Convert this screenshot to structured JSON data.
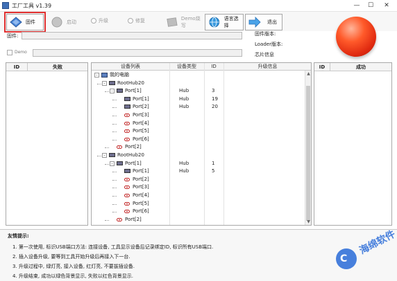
{
  "window": {
    "title": "工厂工具 v1.39",
    "minimize": "—",
    "maximize": "☐",
    "close": "✕"
  },
  "toolbar": {
    "firmware": "固件",
    "start": "启动",
    "upgrade_radio": "升级",
    "repair_radio": "修复",
    "demo_write": "Demo烧写",
    "language": "语言选择",
    "exit": "退出"
  },
  "info": {
    "firmware_label": "固件:",
    "demo_label": "Demo",
    "firmware_version_label": "固件版本:",
    "loader_version_label": "Loader版本:",
    "chip_info_label": "芯片信息"
  },
  "failed_panel": {
    "id_header": "ID",
    "title": "失败"
  },
  "success_panel": {
    "id_header": "ID",
    "title": "成功"
  },
  "device_table": {
    "headers": [
      "设备列表",
      "设备类型",
      "ID",
      "升级信息"
    ],
    "rows": [
      {
        "indent": 0,
        "icon": "pc",
        "expander": "-",
        "name": "我的电脑",
        "type": "",
        "id": ""
      },
      {
        "indent": 1,
        "icon": "hub",
        "expander": "-",
        "name": "RootHub20",
        "type": "",
        "id": ""
      },
      {
        "indent": 2,
        "icon": "hub",
        "expander": "-",
        "name": "Port[1]",
        "type": "Hub",
        "id": "3"
      },
      {
        "indent": 3,
        "icon": "hub",
        "expander": "",
        "name": "Port[1]",
        "type": "Hub",
        "id": "19"
      },
      {
        "indent": 3,
        "icon": "hub",
        "expander": "",
        "name": "Port[2]",
        "type": "Hub",
        "id": "20"
      },
      {
        "indent": 3,
        "icon": "port",
        "expander": "",
        "name": "Port[3]",
        "type": "",
        "id": ""
      },
      {
        "indent": 3,
        "icon": "port",
        "expander": "",
        "name": "Port[4]",
        "type": "",
        "id": ""
      },
      {
        "indent": 3,
        "icon": "port",
        "expander": "",
        "name": "Port[5]",
        "type": "",
        "id": ""
      },
      {
        "indent": 3,
        "icon": "port",
        "expander": "",
        "name": "Port[6]",
        "type": "",
        "id": ""
      },
      {
        "indent": 2,
        "icon": "port",
        "expander": "",
        "name": "Port[2]",
        "type": "",
        "id": ""
      },
      {
        "indent": 1,
        "icon": "hub",
        "expander": "-",
        "name": "RootHub20",
        "type": "",
        "id": ""
      },
      {
        "indent": 2,
        "icon": "hub",
        "expander": "-",
        "name": "Port[1]",
        "type": "Hub",
        "id": "1"
      },
      {
        "indent": 3,
        "icon": "hub",
        "expander": "",
        "name": "Port[1]",
        "type": "Hub",
        "id": "5"
      },
      {
        "indent": 3,
        "icon": "port",
        "expander": "",
        "name": "Port[2]",
        "type": "",
        "id": ""
      },
      {
        "indent": 3,
        "icon": "port",
        "expander": "",
        "name": "Port[3]",
        "type": "",
        "id": ""
      },
      {
        "indent": 3,
        "icon": "port",
        "expander": "",
        "name": "Port[4]",
        "type": "",
        "id": ""
      },
      {
        "indent": 3,
        "icon": "port",
        "expander": "",
        "name": "Port[5]",
        "type": "",
        "id": ""
      },
      {
        "indent": 3,
        "icon": "port",
        "expander": "",
        "name": "Port[6]",
        "type": "",
        "id": ""
      },
      {
        "indent": 2,
        "icon": "port",
        "expander": "",
        "name": "Port[2]",
        "type": "",
        "id": ""
      }
    ]
  },
  "tips": {
    "title": "友情提示:",
    "lines": [
      "1. 第一次使用, 标识USB端口方法: 连接设备, 工具显示设备后记录绑定ID, 标识所有USB端口.",
      "2. 插入设备升级, 要等到工具开始升级后再接入下一台.",
      "3. 升级过程中, 绿灯亮, 接入设备, 红灯亮, 不要拔插设备.",
      "4. 升级结束, 成功以绿色背景显示, 失败以红色背景显示."
    ]
  },
  "watermark": {
    "text": "海绵软件"
  },
  "colors": {
    "start_button": "#e02a10",
    "highlight_outline": "#e03030",
    "watermark": "#2f6fd9"
  }
}
